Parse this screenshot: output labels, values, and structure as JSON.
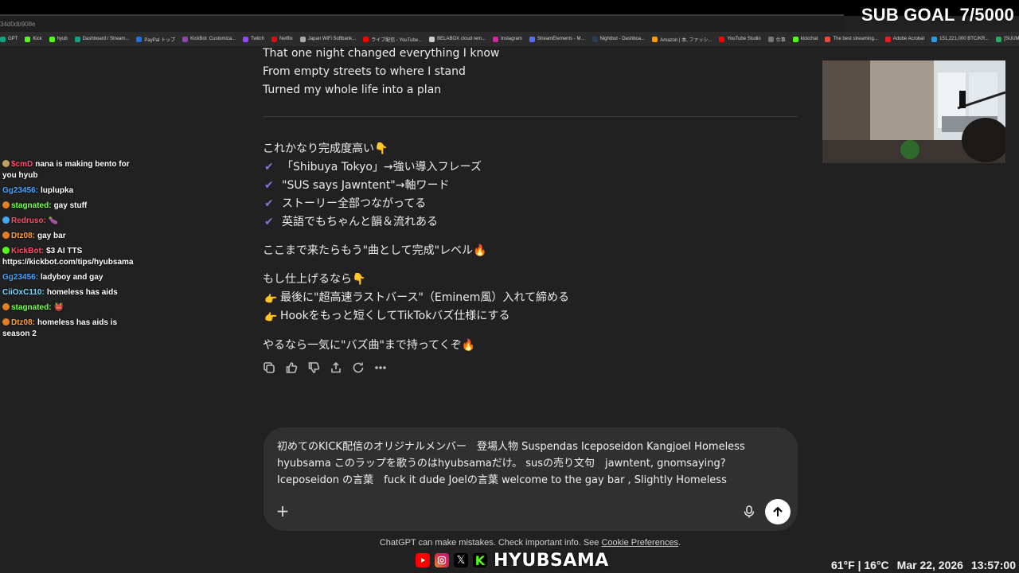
{
  "overlay": {
    "sub_goal": "SUB GOAL 7/5000",
    "brand": "HYUBSAMA",
    "weather": "61°F | 16°C",
    "date": "Mar 22, 2026",
    "time": "13:57:00"
  },
  "browser": {
    "url_fragment": "34d0db908e",
    "bookmarks": [
      {
        "label": "GPT",
        "color": "#10a37f"
      },
      {
        "label": "Kick",
        "color": "#53fc18"
      },
      {
        "label": "hyub",
        "color": "#53fc18"
      },
      {
        "label": "Dashboard / Stream...",
        "color": "#16a085"
      },
      {
        "label": "PayPal トップ",
        "color": "#1a73e8"
      },
      {
        "label": "KickBot: Customiza...",
        "color": "#8e44ad"
      },
      {
        "label": "Twitch",
        "color": "#9146ff"
      },
      {
        "label": "Netflix",
        "color": "#e50914"
      },
      {
        "label": "Japan WiFi Softbank...",
        "color": "#aaaaaa"
      },
      {
        "label": "ライブ配信 - YouTube...",
        "color": "#ff0000"
      },
      {
        "label": "BELABOX cloud rem...",
        "color": "#cccccc"
      },
      {
        "label": "Instagram",
        "color": "#d6249f"
      },
      {
        "label": "StreamElements - M...",
        "color": "#5a6cff"
      },
      {
        "label": "Nightbot - Dashboa...",
        "color": "#2c3e50"
      },
      {
        "label": "Amazon | 本, ファッシ...",
        "color": "#ff9900"
      },
      {
        "label": "YouTube Studio",
        "color": "#ff0000"
      },
      {
        "label": "仕事",
        "color": "#777777"
      },
      {
        "label": "kickchat",
        "color": "#53fc18"
      },
      {
        "label": "The best streaming...",
        "color": "#e74c3c"
      },
      {
        "label": "Adobe Acrobat",
        "color": "#ec1c24"
      },
      {
        "label": "151,221,000 BTC/KR...",
        "color": "#3498db"
      },
      {
        "label": "[SUUMO] U R B I ...",
        "color": "#27ae60"
      }
    ]
  },
  "stream_chat": [
    {
      "user": "$cmD",
      "user_color": "#ff4d6d",
      "text": "nana is making bento for you hyub",
      "icon_color": "#c0a060"
    },
    {
      "user": "Gg23456:",
      "user_color": "#4aa3ff",
      "text": "luplupka",
      "icon_color": ""
    },
    {
      "user": "stagnated:",
      "user_color": "#7dff5a",
      "text": "gay stuff",
      "icon_color": "#e67e22"
    },
    {
      "user": "Redruso:",
      "user_color": "#ff4d6d",
      "text": "🍆",
      "icon_color": "#3fa9f5"
    },
    {
      "user": "Dtz08:",
      "user_color": "#ff9e3d",
      "text": "gay bar",
      "icon_color": "#e67e22"
    },
    {
      "user": "KickBot:",
      "user_color": "#ff4d6d",
      "text": "$3 AI TTS https://kickbot.com/tips/hyubsama",
      "icon_color": "#53fc18"
    },
    {
      "user": "Gg23456:",
      "user_color": "#4aa3ff",
      "text": "ladyboy and gay",
      "icon_color": ""
    },
    {
      "user": "CiiOxC110:",
      "user_color": "#7fd6ff",
      "text": "homeless has aids",
      "icon_color": ""
    },
    {
      "user": "stagnated:",
      "user_color": "#7dff5a",
      "text": "👹",
      "icon_color": "#e67e22"
    },
    {
      "user": "Dtz08:",
      "user_color": "#ff9e3d",
      "text": "homeless has aids is season 2",
      "icon_color": "#e67e22"
    }
  ],
  "conversation": {
    "lyrics": [
      "That one night changed everything I know",
      "From empty streets to where I stand",
      "Turned my whole life into a plan"
    ],
    "intro": "これかなり完成度高い👇",
    "checks": [
      "「Shibuya Tokyo」→強い導入フレーズ",
      "\"SUS says Jawntent\"→軸ワード",
      "ストーリー全部つながってる",
      "英語でもちゃんと韻＆流れある"
    ],
    "complete_line": "ここまで来たらもう\"曲として完成\"レベル🔥",
    "finish_intro": "もし仕上げるなら👇",
    "suggestions": [
      "最後に\"超高速ラストバース\"（Eminem風）入れて締める",
      "Hookをもっと短くしてTikTokバズ仕様にする"
    ],
    "closing": "やるなら一気に\"バズ曲\"まで持ってくぞ🔥"
  },
  "composer": {
    "text": "初めてのKICK配信のオリジナルメンバー　登場人物 Suspendas Iceposeidon Kangjoel Homeless hyubsama このラップを歌うのはhyubsamaだけ。 susの売り文句　jawntent, gnomsaying? Iceposeidon の言葉　fuck it dude Joelの言葉 welcome to the gay bar , Slightly Homeless"
  },
  "footer": {
    "disclaimer": "ChatGPT can make mistakes. Check important info. See ",
    "link": "Cookie Preferences",
    "period": "."
  }
}
